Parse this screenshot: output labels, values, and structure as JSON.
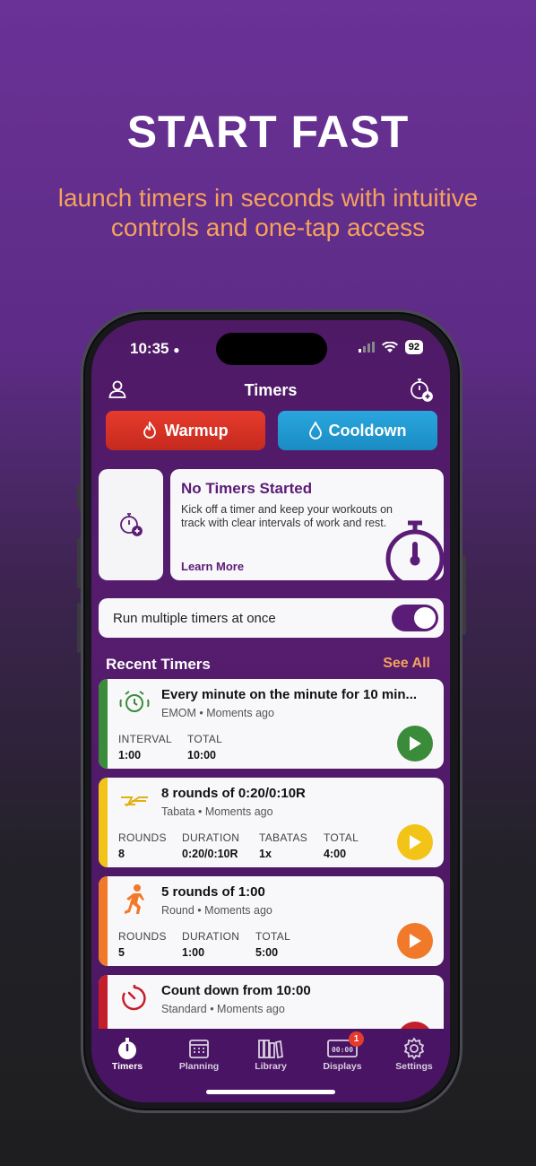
{
  "promo": {
    "headline": "START FAST",
    "subline": "launch timers in seconds with intuitive controls and one-tap access"
  },
  "status": {
    "time": "10:35",
    "battery": "92"
  },
  "nav": {
    "title": "Timers"
  },
  "quick": {
    "warmup": "Warmup",
    "cooldown": "Cooldown"
  },
  "info_card": {
    "title": "No Timers Started",
    "text": "Kick off a timer and keep your workouts on track with clear intervals of work and rest.",
    "link": "Learn More"
  },
  "toggle": {
    "label": "Run multiple timers at once",
    "on": true
  },
  "recent": {
    "heading": "Recent Timers",
    "see_all": "See All",
    "cards": [
      {
        "title": "Every minute on the minute for 10 min...",
        "sub": "EMOM • Moments ago",
        "color": "#3a8c3a",
        "stats": [
          {
            "label": "INTERVAL",
            "value": "1:00"
          },
          {
            "label": "TOTAL",
            "value": "10:00"
          }
        ]
      },
      {
        "title": "8 rounds of 0:20/0:10R",
        "sub": "Tabata • Moments ago",
        "color": "#f2c418",
        "stats": [
          {
            "label": "ROUNDS",
            "value": "8"
          },
          {
            "label": "DURATION",
            "value": "0:20/0:10R"
          },
          {
            "label": "TABATAS",
            "value": "1x"
          },
          {
            "label": "TOTAL",
            "value": "4:00"
          }
        ]
      },
      {
        "title": "5 rounds of 1:00",
        "sub": "Round • Moments ago",
        "color": "#f07a2a",
        "stats": [
          {
            "label": "ROUNDS",
            "value": "5"
          },
          {
            "label": "DURATION",
            "value": "1:00"
          },
          {
            "label": "TOTAL",
            "value": "5:00"
          }
        ]
      },
      {
        "title": "Count down from 10:00",
        "sub": "Standard • Moments ago",
        "color": "#c41e2a",
        "stats": []
      }
    ]
  },
  "tabs": [
    {
      "label": "Timers",
      "icon": "stopwatch-icon"
    },
    {
      "label": "Planning",
      "icon": "calendar-icon"
    },
    {
      "label": "Library",
      "icon": "books-icon"
    },
    {
      "label": "Displays",
      "icon": "display-icon",
      "badge": "1"
    },
    {
      "label": "Settings",
      "icon": "gear-icon"
    }
  ]
}
